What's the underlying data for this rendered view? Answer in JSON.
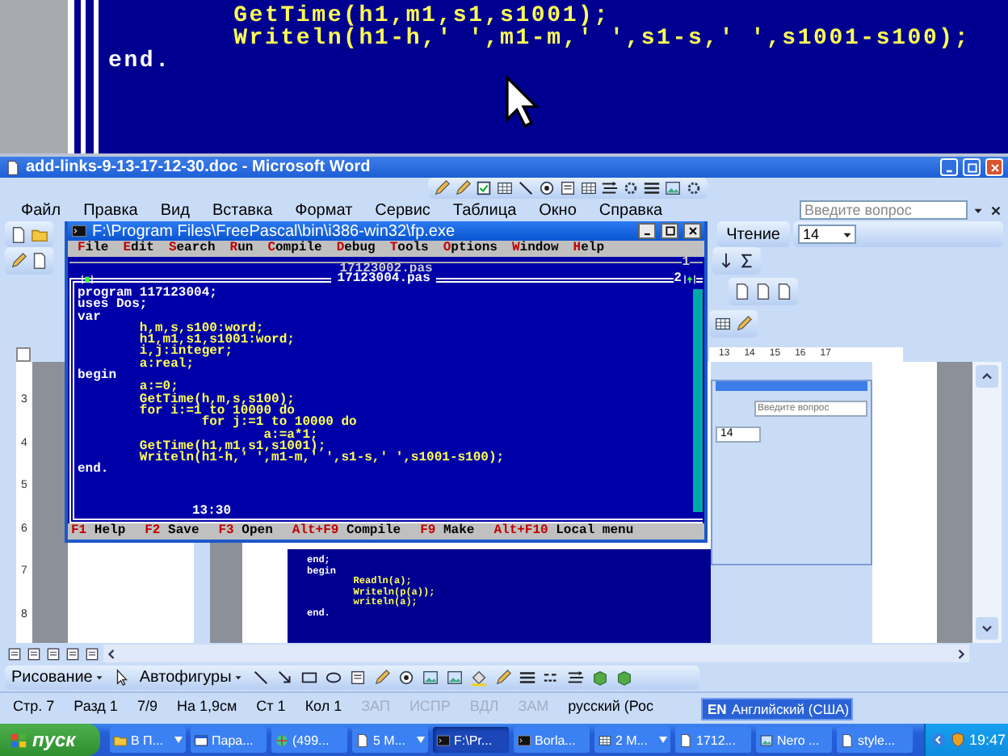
{
  "background_code": {
    "lines": [
      {
        "text": "        GetTime(h1,m1,s1,s1001);",
        "kind": "code"
      },
      {
        "text": "        Writeln(h1-h,' ',m1-m,' ',s1-s,' ',s1001-s100);",
        "kind": "code"
      },
      {
        "text": "end.",
        "kind": "keyword"
      }
    ]
  },
  "word_window": {
    "title": "add-links-9-13-17-12-30.doc - Microsoft Word",
    "menu": [
      "Файл",
      "Правка",
      "Вид",
      "Вставка",
      "Формат",
      "Сервис",
      "Таблица",
      "Окно",
      "Справка"
    ],
    "help_search": {
      "placeholder": "Введите вопрос"
    },
    "view_button": "Чтение",
    "font_size": "14",
    "ruler_numbers": [
      "13",
      "14",
      "15",
      "16",
      "17"
    ],
    "vertical_ruler_numbers": [
      "3",
      "4",
      "5",
      "6",
      "7",
      "8"
    ],
    "embedded_window": {
      "help_search": {
        "placeholder": "Введите вопрос"
      },
      "font_size": "14"
    },
    "embedded_code": [
      {
        "text": "end;",
        "kind": "keyword"
      },
      {
        "text": "begin",
        "kind": "keyword"
      },
      {
        "text": "        Readln(a);",
        "kind": "code"
      },
      {
        "text": "        Writeln(p(a));",
        "kind": "code"
      },
      {
        "text": "        writeln(a);",
        "kind": "code"
      },
      {
        "text": "end.",
        "kind": "keyword"
      }
    ],
    "drawing_toolbar": {
      "drawing_menu": "Рисование",
      "autoshapes_menu": "Автофигуры"
    },
    "status_bar": [
      {
        "text": "Стр. 7",
        "disabled": false
      },
      {
        "text": "Разд 1",
        "disabled": false
      },
      {
        "text": "7/9",
        "disabled": false
      },
      {
        "text": "На 1,9см",
        "disabled": false
      },
      {
        "text": "Ст 1",
        "disabled": false
      },
      {
        "text": "Кол 1",
        "disabled": false
      },
      {
        "text": "ЗАП",
        "disabled": true
      },
      {
        "text": "ИСПР",
        "disabled": true
      },
      {
        "text": "ВДЛ",
        "disabled": true
      },
      {
        "text": "ЗАМ",
        "disabled": true
      },
      {
        "text": "русский (Рос",
        "disabled": false
      }
    ]
  },
  "fp_window": {
    "title": "F:\\Program Files\\FreePascal\\bin\\i386-win32\\fp.exe",
    "menu": [
      "File",
      "Edit",
      "Search",
      "Run",
      "Compile",
      "Debug",
      "Tools",
      "Options",
      "Window",
      "Help"
    ],
    "back_editor": {
      "file": "17123002.pas",
      "number": "1"
    },
    "editor": {
      "file": "17123004.pas",
      "number": "2",
      "cursor_position": "13:30",
      "lines": [
        {
          "text": "program 117123004;",
          "kind": "keyword"
        },
        {
          "text": "uses Dos;",
          "kind": "keyword"
        },
        {
          "text": "var",
          "kind": "keyword"
        },
        {
          "text": "        h,m,s,s100:word;",
          "kind": "code"
        },
        {
          "text": "        h1,m1,s1,s1001:word;",
          "kind": "code"
        },
        {
          "text": "        i,j:integer;",
          "kind": "code"
        },
        {
          "text": "        a:real;",
          "kind": "code"
        },
        {
          "text": "begin",
          "kind": "keyword"
        },
        {
          "text": "        a:=0;",
          "kind": "code"
        },
        {
          "text": "        GetTime(h,m,s,s100);",
          "kind": "code"
        },
        {
          "text": "        for i:=1 to 10000 do",
          "kind": "code"
        },
        {
          "text": "                for j:=1 to 10000 do",
          "kind": "code"
        },
        {
          "text": "                        a:=a*1;",
          "kind": "code"
        },
        {
          "text": "        GetTime(h1,m1,s1,s1001);",
          "kind": "code"
        },
        {
          "text": "        Writeln(h1-h,' ',m1-m,' ',s1-s,' ',s1001-s100);",
          "kind": "code"
        },
        {
          "text": "end.",
          "kind": "keyword"
        }
      ]
    },
    "status_line": [
      {
        "key": "F1",
        "label": "Help"
      },
      {
        "key": "F2",
        "label": "Save"
      },
      {
        "key": "F3",
        "label": "Open"
      },
      {
        "key": "Alt+F9",
        "label": "Compile"
      },
      {
        "key": "F9",
        "label": "Make"
      },
      {
        "key": "Alt+F10",
        "label": "Local menu"
      }
    ]
  },
  "language_bar": {
    "code": "EN",
    "label": "Английский (США)"
  },
  "taskbar": {
    "start": "пуск",
    "clock": "19:47",
    "tasks": [
      {
        "label": "В П...",
        "selected": false,
        "grouped": true
      },
      {
        "label": "Пара...",
        "selected": false,
        "grouped": false
      },
      {
        "label": "(499...",
        "selected": false,
        "grouped": false
      },
      {
        "label": "5 M...",
        "selected": false,
        "grouped": true
      },
      {
        "label": "F:\\Pr...",
        "selected": true,
        "grouped": false
      },
      {
        "label": "Borla...",
        "selected": false,
        "grouped": false
      },
      {
        "label": "2 M...",
        "selected": false,
        "grouped": true
      },
      {
        "label": "1712...",
        "selected": false,
        "grouped": false
      },
      {
        "label": "Nero ...",
        "selected": false,
        "grouped": false
      },
      {
        "label": "style...",
        "selected": false,
        "grouped": false
      }
    ]
  }
}
